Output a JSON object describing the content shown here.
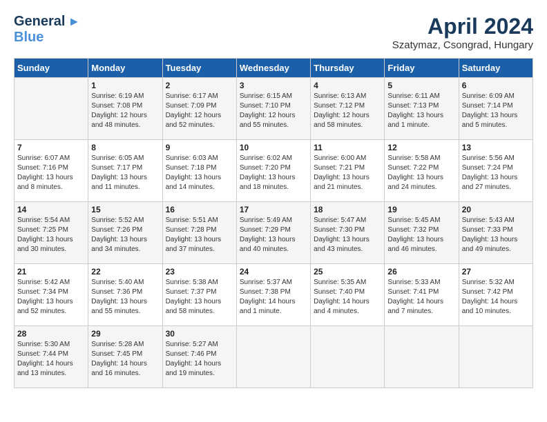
{
  "header": {
    "logo_general": "General",
    "logo_blue": "Blue",
    "month_year": "April 2024",
    "location": "Szatymaz, Csongrad, Hungary"
  },
  "columns": [
    "Sunday",
    "Monday",
    "Tuesday",
    "Wednesday",
    "Thursday",
    "Friday",
    "Saturday"
  ],
  "weeks": [
    [
      {
        "day": "",
        "info": ""
      },
      {
        "day": "1",
        "info": "Sunrise: 6:19 AM\nSunset: 7:08 PM\nDaylight: 12 hours\nand 48 minutes."
      },
      {
        "day": "2",
        "info": "Sunrise: 6:17 AM\nSunset: 7:09 PM\nDaylight: 12 hours\nand 52 minutes."
      },
      {
        "day": "3",
        "info": "Sunrise: 6:15 AM\nSunset: 7:10 PM\nDaylight: 12 hours\nand 55 minutes."
      },
      {
        "day": "4",
        "info": "Sunrise: 6:13 AM\nSunset: 7:12 PM\nDaylight: 12 hours\nand 58 minutes."
      },
      {
        "day": "5",
        "info": "Sunrise: 6:11 AM\nSunset: 7:13 PM\nDaylight: 13 hours\nand 1 minute."
      },
      {
        "day": "6",
        "info": "Sunrise: 6:09 AM\nSunset: 7:14 PM\nDaylight: 13 hours\nand 5 minutes."
      }
    ],
    [
      {
        "day": "7",
        "info": "Sunrise: 6:07 AM\nSunset: 7:16 PM\nDaylight: 13 hours\nand 8 minutes."
      },
      {
        "day": "8",
        "info": "Sunrise: 6:05 AM\nSunset: 7:17 PM\nDaylight: 13 hours\nand 11 minutes."
      },
      {
        "day": "9",
        "info": "Sunrise: 6:03 AM\nSunset: 7:18 PM\nDaylight: 13 hours\nand 14 minutes."
      },
      {
        "day": "10",
        "info": "Sunrise: 6:02 AM\nSunset: 7:20 PM\nDaylight: 13 hours\nand 18 minutes."
      },
      {
        "day": "11",
        "info": "Sunrise: 6:00 AM\nSunset: 7:21 PM\nDaylight: 13 hours\nand 21 minutes."
      },
      {
        "day": "12",
        "info": "Sunrise: 5:58 AM\nSunset: 7:22 PM\nDaylight: 13 hours\nand 24 minutes."
      },
      {
        "day": "13",
        "info": "Sunrise: 5:56 AM\nSunset: 7:24 PM\nDaylight: 13 hours\nand 27 minutes."
      }
    ],
    [
      {
        "day": "14",
        "info": "Sunrise: 5:54 AM\nSunset: 7:25 PM\nDaylight: 13 hours\nand 30 minutes."
      },
      {
        "day": "15",
        "info": "Sunrise: 5:52 AM\nSunset: 7:26 PM\nDaylight: 13 hours\nand 34 minutes."
      },
      {
        "day": "16",
        "info": "Sunrise: 5:51 AM\nSunset: 7:28 PM\nDaylight: 13 hours\nand 37 minutes."
      },
      {
        "day": "17",
        "info": "Sunrise: 5:49 AM\nSunset: 7:29 PM\nDaylight: 13 hours\nand 40 minutes."
      },
      {
        "day": "18",
        "info": "Sunrise: 5:47 AM\nSunset: 7:30 PM\nDaylight: 13 hours\nand 43 minutes."
      },
      {
        "day": "19",
        "info": "Sunrise: 5:45 AM\nSunset: 7:32 PM\nDaylight: 13 hours\nand 46 minutes."
      },
      {
        "day": "20",
        "info": "Sunrise: 5:43 AM\nSunset: 7:33 PM\nDaylight: 13 hours\nand 49 minutes."
      }
    ],
    [
      {
        "day": "21",
        "info": "Sunrise: 5:42 AM\nSunset: 7:34 PM\nDaylight: 13 hours\nand 52 minutes."
      },
      {
        "day": "22",
        "info": "Sunrise: 5:40 AM\nSunset: 7:36 PM\nDaylight: 13 hours\nand 55 minutes."
      },
      {
        "day": "23",
        "info": "Sunrise: 5:38 AM\nSunset: 7:37 PM\nDaylight: 13 hours\nand 58 minutes."
      },
      {
        "day": "24",
        "info": "Sunrise: 5:37 AM\nSunset: 7:38 PM\nDaylight: 14 hours\nand 1 minute."
      },
      {
        "day": "25",
        "info": "Sunrise: 5:35 AM\nSunset: 7:40 PM\nDaylight: 14 hours\nand 4 minutes."
      },
      {
        "day": "26",
        "info": "Sunrise: 5:33 AM\nSunset: 7:41 PM\nDaylight: 14 hours\nand 7 minutes."
      },
      {
        "day": "27",
        "info": "Sunrise: 5:32 AM\nSunset: 7:42 PM\nDaylight: 14 hours\nand 10 minutes."
      }
    ],
    [
      {
        "day": "28",
        "info": "Sunrise: 5:30 AM\nSunset: 7:44 PM\nDaylight: 14 hours\nand 13 minutes."
      },
      {
        "day": "29",
        "info": "Sunrise: 5:28 AM\nSunset: 7:45 PM\nDaylight: 14 hours\nand 16 minutes."
      },
      {
        "day": "30",
        "info": "Sunrise: 5:27 AM\nSunset: 7:46 PM\nDaylight: 14 hours\nand 19 minutes."
      },
      {
        "day": "",
        "info": ""
      },
      {
        "day": "",
        "info": ""
      },
      {
        "day": "",
        "info": ""
      },
      {
        "day": "",
        "info": ""
      }
    ]
  ]
}
